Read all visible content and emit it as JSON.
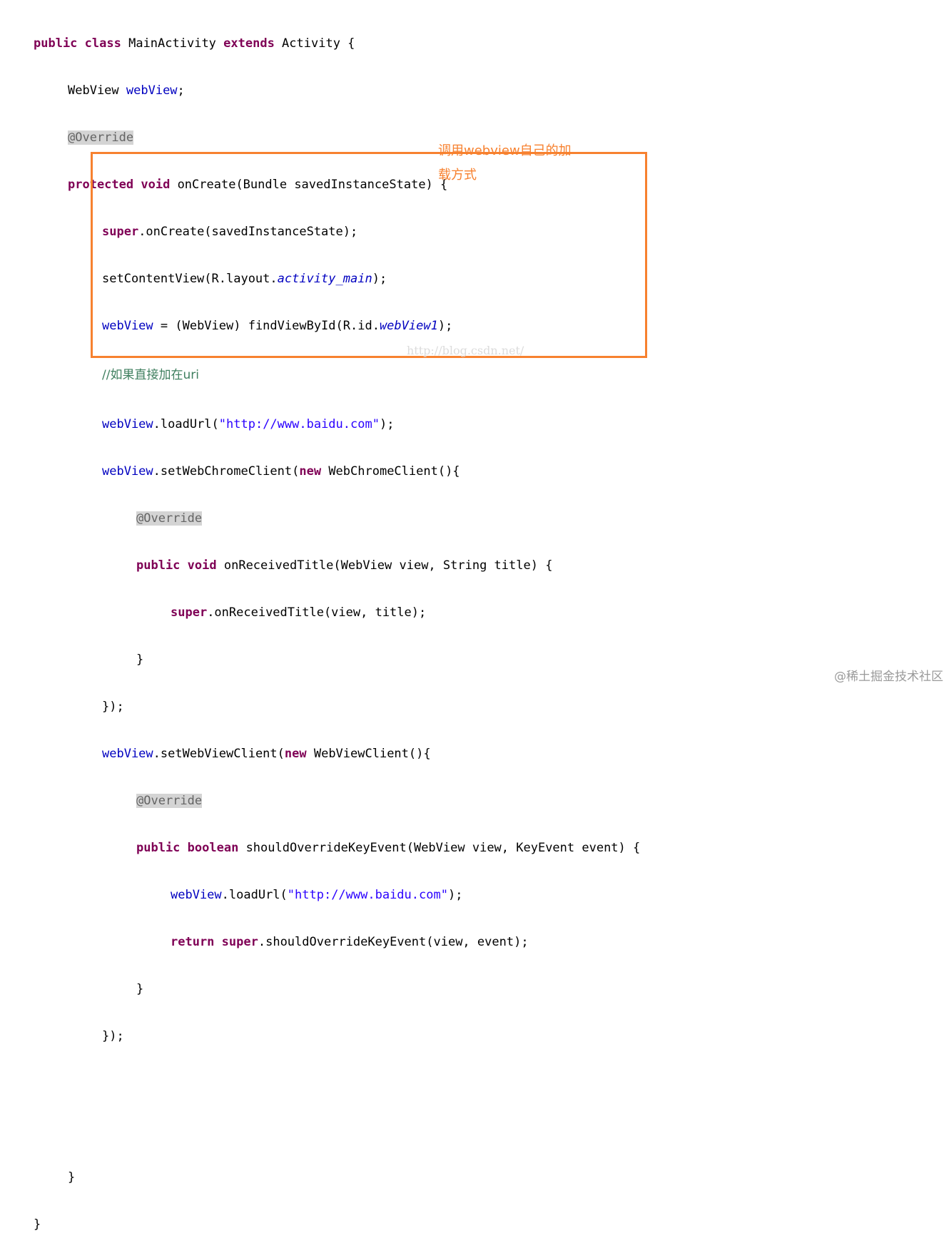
{
  "code": {
    "l1": {
      "kw1": "public",
      "kw2": "class",
      "t1": " MainActivity ",
      "kw3": "extends",
      "t2": " Activity {"
    },
    "l2": {
      "t1": "WebView ",
      "f1": "webView",
      "t2": ";"
    },
    "l3": {
      "ann": "@Override"
    },
    "l4": {
      "kw1": "protected",
      "kw2": "void",
      "t1": " onCreate(Bundle savedInstanceState) {"
    },
    "l5": {
      "kw1": "super",
      "t1": ".onCreate(savedInstanceState);"
    },
    "l6": {
      "t1": "setContentView(R.layout.",
      "f1": "activity_main",
      "t2": ");"
    },
    "l7": {
      "f1": "webView",
      "t1": " = (WebView) findViewById(R.id.",
      "f2": "webView1",
      "t2": ");"
    },
    "l8": {
      "cmt": "//如果直接加在uri"
    },
    "l9": {
      "f1": "webView",
      "t1": ".loadUrl(",
      "s1": "\"http://www.baidu.com\"",
      "t2": ");"
    },
    "l10": {
      "f1": "webView",
      "t1": ".setWebChromeClient(",
      "kw1": "new",
      "t2": " WebChromeClient(){"
    },
    "l11": {
      "ann": "@Override"
    },
    "l12": {
      "kw1": "public",
      "kw2": "void",
      "t1": " onReceivedTitle(WebView view, String title) {"
    },
    "l13": {
      "kw1": "super",
      "t1": ".onReceivedTitle(view, title);"
    },
    "l14": {
      "t1": "}"
    },
    "l15": {
      "t1": "});"
    },
    "l16": {
      "f1": "webView",
      "t1": ".setWebViewClient(",
      "kw1": "new",
      "t2": " WebViewClient(){"
    },
    "l17": {
      "ann": "@Override"
    },
    "l18": {
      "kw1": "public",
      "kw2": "boolean",
      "t1": " shouldOverrideKeyEvent(WebView view, KeyEvent event) {"
    },
    "l19": {
      "f1": "webView",
      "t1": ".loadUrl(",
      "s1": "\"http://www.baidu.com\"",
      "t2": ");"
    },
    "l20": {
      "kw1": "return",
      "kw2": "super",
      "t1": ".shouldOverrideKeyEvent(view, event);"
    },
    "l21": {
      "t1": "}"
    },
    "l22": {
      "t1": "});"
    },
    "l23": {
      "t1": "}"
    },
    "l24": {
      "t1": "}"
    }
  },
  "annotation": {
    "note_line1": "调用webview自己的加",
    "note_line2": "载方式",
    "box_color": "#f7812f"
  },
  "watermarks": {
    "center": "http://blog.csdn.net/",
    "corner": "@稀土掘金技术社区"
  },
  "colors": {
    "keyword": "#7f0055",
    "field": "#0000c0",
    "string": "#2a00ff",
    "comment": "#3f7f5f",
    "annotation": "#646464"
  }
}
